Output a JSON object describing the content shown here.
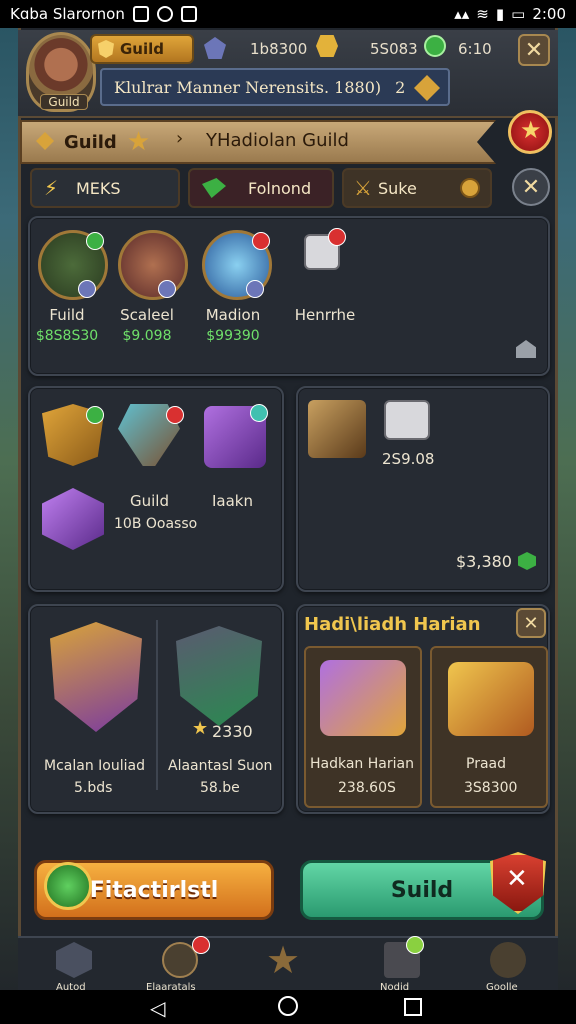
{
  "status_bar": {
    "carrier": "Kɑba Slarornon",
    "time": "2:00"
  },
  "header": {
    "avatar_label": "Guild",
    "guild_label": "Guild",
    "res1": "1b8300",
    "res2": "5S083",
    "res3": "6:10",
    "banner_text": "Klulrar Manner Nerensits. 1880)",
    "banner_num": "2"
  },
  "ribbon": {
    "tab_label": "Guild",
    "title": "YHadiolan Guild"
  },
  "tabs": [
    {
      "label": "MEKS"
    },
    {
      "label": "Folnond"
    },
    {
      "label": "Suke"
    }
  ],
  "heroes": [
    {
      "name": "Fuild",
      "price": "$8S8S30"
    },
    {
      "name": "Scaleel",
      "price": "$9.098"
    },
    {
      "name": "Madion",
      "price": "$99390"
    },
    {
      "name": "Henrrhe",
      "price": ""
    }
  ],
  "items_panel": {
    "label1": "Guild",
    "label1_sub": "10B Ooasso",
    "label2": "Iaakn"
  },
  "right_panel": {
    "value": "2S9.08",
    "price": "$3,380"
  },
  "chests": [
    {
      "name": "Mcalan Iouliad",
      "value": "5.bds"
    },
    {
      "name": "Alaantasl Suon",
      "value": "58.be",
      "star_value": "2330"
    }
  ],
  "offer_panel": {
    "title": "Hadi\\liadh Harian",
    "cards": [
      {
        "name": "Hadkan Harian",
        "value": "238.60S"
      },
      {
        "name": "Praad",
        "value": "3S8300"
      }
    ]
  },
  "buttons": {
    "left": "Fitactirlstl",
    "right": "Suild"
  },
  "nav_labels": [
    "Autod",
    "Elaaratals",
    "",
    "Nodid",
    "Goolle"
  ]
}
